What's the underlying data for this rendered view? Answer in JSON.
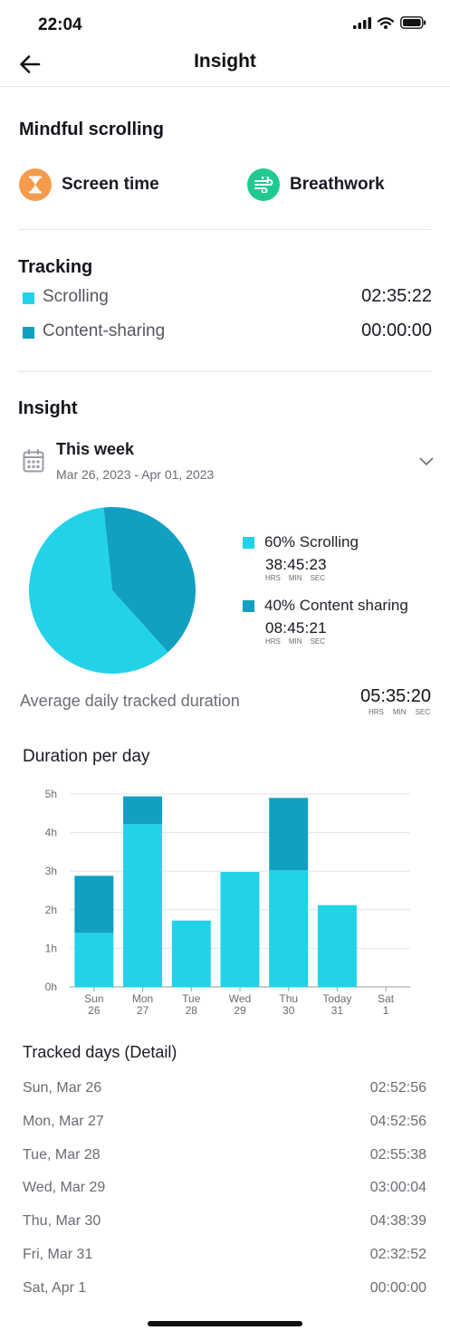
{
  "status_bar": {
    "time": "22:04",
    "icons": [
      "signal-icon",
      "wifi-icon",
      "battery-icon"
    ]
  },
  "header": {
    "title": "Insight",
    "back_icon": "arrow-left-icon"
  },
  "mindful": {
    "title": "Mindful scrolling",
    "features": [
      {
        "label": "Screen time",
        "icon": "hourglass-icon",
        "color": "#F59B4C"
      },
      {
        "label": "Breathwork",
        "icon": "wind-icon",
        "color": "#1FC98F"
      }
    ]
  },
  "tracking": {
    "title": "Tracking",
    "rows": [
      {
        "label": "Scrolling",
        "value": "02:35:22",
        "color": "#22D3E8"
      },
      {
        "label": "Content-sharing",
        "value": "00:00:00",
        "color": "#12A0C2"
      }
    ]
  },
  "insight": {
    "title": "Insight",
    "week": {
      "title": "This week",
      "range": "Mar 26, 2023 - Apr 01, 2023",
      "icon": "calendar-icon",
      "dropdown_icon": "chevron-down-icon"
    },
    "legend": [
      {
        "label": "60% Scrolling",
        "time": "38:45:23",
        "color": "#22D3E8"
      },
      {
        "label": "40% Content sharing",
        "time": "08:45:21",
        "color": "#12A0C2"
      }
    ],
    "units": {
      "hrs": "HRS",
      "min": "MIN",
      "sec": "SEC"
    },
    "average": {
      "label": "Average daily tracked duration",
      "value": "05:35:20"
    }
  },
  "chart_title": "Duration per day",
  "chart_data": [
    {
      "type": "pie",
      "labels": [
        "Scrolling",
        "Content sharing"
      ],
      "values": [
        60,
        40
      ],
      "colors": [
        "#22D3E8",
        "#12A0C2"
      ]
    },
    {
      "type": "bar",
      "stacked": true,
      "title": "Duration per day",
      "categories": [
        [
          "Sun",
          "26"
        ],
        [
          "Mon",
          "27"
        ],
        [
          "Tue",
          "28"
        ],
        [
          "Wed",
          "29"
        ],
        [
          "Thu",
          "30"
        ],
        [
          "Today",
          "31"
        ],
        [
          "Sat",
          "1"
        ]
      ],
      "series": [
        {
          "values": [
            1.4,
            4.22,
            1.72,
            2.98,
            3.02,
            2.12,
            0
          ],
          "color": "#22D3E8"
        },
        {
          "values": [
            1.48,
            0.72,
            0,
            0,
            1.88,
            0,
            0
          ],
          "color": "#12A0C2"
        }
      ],
      "yticks": [
        "0h",
        "1h",
        "2h",
        "3h",
        "4h",
        "5h"
      ],
      "ylim": [
        0,
        5
      ],
      "grid": true
    }
  ],
  "detail": {
    "title": "Tracked days (Detail)",
    "rows": [
      {
        "day": "Sun, Mar 26",
        "time": "02:52:56"
      },
      {
        "day": "Mon, Mar 27",
        "time": "04:52:56"
      },
      {
        "day": "Tue, Mar 28",
        "time": "02:55:38"
      },
      {
        "day": "Wed, Mar 29",
        "time": "03:00:04"
      },
      {
        "day": "Thu, Mar 30",
        "time": "04:38:39"
      },
      {
        "day": "Fri, Mar 31",
        "time": "02:32:52"
      },
      {
        "day": "Sat, Apr 1",
        "time": "00:00:00"
      }
    ]
  }
}
